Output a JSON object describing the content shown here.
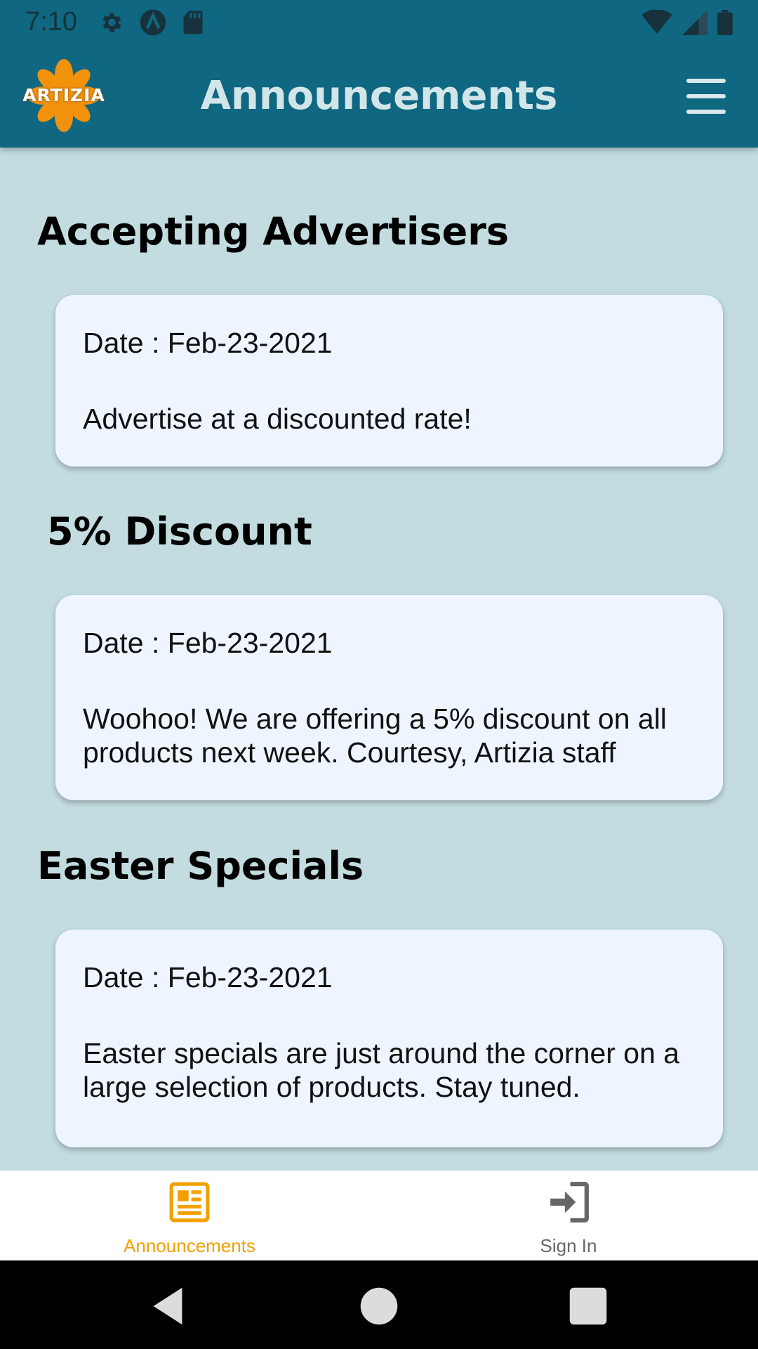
{
  "status_bar": {
    "time": "7:10",
    "icons": [
      "settings-icon",
      "a-icon",
      "sd-card-icon",
      "wifi-icon",
      "signal-icon",
      "battery-icon"
    ]
  },
  "app_bar": {
    "logo_text": "ARTIZIA",
    "title": "Announcements",
    "menu_icon": "hamburger-menu-icon"
  },
  "announcements": [
    {
      "title": "Accepting Advertisers",
      "date": "Date : Feb-23-2021",
      "body": "Advertise at a discounted rate!"
    },
    {
      "title": "5% Discount",
      "date": "Date : Feb-23-2021",
      "body": "Woohoo! We are offering a 5% discount on all products next week. Courtesy, Artizia staff"
    },
    {
      "title": "Easter Specials",
      "date": "Date : Feb-23-2021",
      "body": "Easter specials are just around the corner on a large selection of products. Stay tuned."
    }
  ],
  "bottom_nav": {
    "items": [
      {
        "label": "Announcements",
        "icon": "newspaper-icon",
        "active": true
      },
      {
        "label": "Sign In",
        "icon": "sign-in-icon",
        "active": false
      }
    ]
  },
  "system_nav": [
    "back-icon",
    "home-icon",
    "recents-icon"
  ],
  "colors": {
    "app_bar": "#0f6781",
    "background": "#c3dce0",
    "card": "#eef5ff",
    "accent": "#f2a000"
  }
}
